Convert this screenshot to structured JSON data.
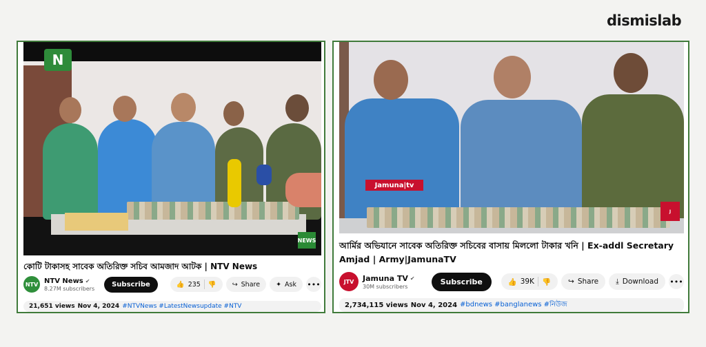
{
  "brand": "dismislab",
  "left": {
    "video_logo": "",
    "video_corner_logo": "",
    "title": "কোটি টাকাসহ সাবেক অতিরিক্ত সচিব আমজাদ আটক | NTV News",
    "channel": {
      "name": "NTV News",
      "subscribers": "8.27M subscribers",
      "avatar_text": "NTV"
    },
    "subscribe_label": "Subscribe",
    "likes": "235",
    "share_label": "Share",
    "ask_label": "Ask",
    "more_label": "•••",
    "views": "21,651 views",
    "date": "Nov 4, 2024",
    "hashtags": "#NTVNews #LatestNewsupdate #NTV"
  },
  "right": {
    "video_banner": "Jamuna|tv",
    "title": "আর্মির অভিযানে সাবেক অতিরিক্ত সচিবের বাসায় মিললো টাকার খনি | Ex-addl Secretary Amjad | Army|JamunaTV",
    "channel": {
      "name": "Jamuna TV",
      "subscribers": "30M subscribers",
      "avatar_text": "JTV"
    },
    "subscribe_label": "Subscribe",
    "likes": "39K",
    "share_label": "Share",
    "download_label": "Download",
    "more_label": "•••",
    "views": "2,734,115 views",
    "date": "Nov 4, 2024",
    "hashtags": "#bdnews #banglanews #নিউজ"
  },
  "colors": {
    "panel_border": "#3f7a3a",
    "jamuna_red": "#c8102e",
    "ntv_green": "#2e8b3a",
    "link_blue": "#065fd4"
  },
  "icons": [
    "like-icon",
    "dislike-icon",
    "share-icon",
    "ask-icon",
    "download-icon",
    "verified-icon"
  ]
}
